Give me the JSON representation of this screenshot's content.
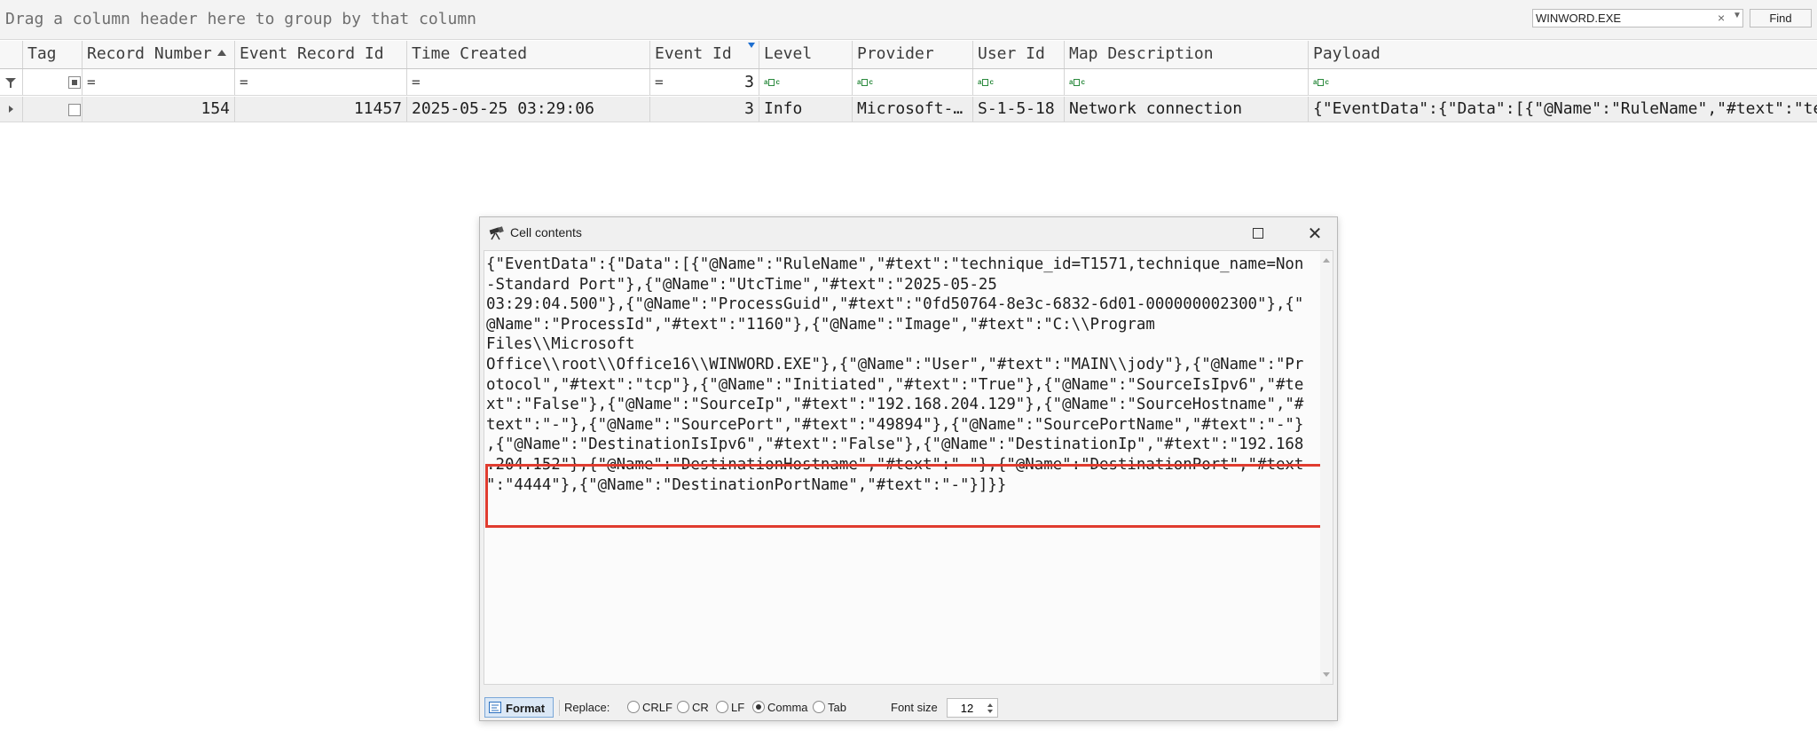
{
  "group_panel": {
    "hint": "Drag a column header here to group by that column",
    "search_value": "WINWORD.EXE",
    "find_label": "Find"
  },
  "columns": [
    {
      "label": "Tag"
    },
    {
      "label": "Record Number"
    },
    {
      "label": "Event Record Id"
    },
    {
      "label": "Time Created"
    },
    {
      "label": "Event Id"
    },
    {
      "label": "Level"
    },
    {
      "label": "Provider"
    },
    {
      "label": "User Id"
    },
    {
      "label": "Map Description"
    },
    {
      "label": "Payload"
    }
  ],
  "filter_row": {
    "eq": "=",
    "event_id_filter": "3"
  },
  "row": {
    "record_number": "154",
    "event_record_id": "11457",
    "time_created": "2025-05-25 03:29:06",
    "event_id": "3",
    "level": "Info",
    "provider": "Microsoft-Windows-Sysmon",
    "user_id": "S-1-5-18",
    "map_description": "Network connection",
    "payload": "{\"EventData\":{\"Data\":[{\"@Name\":\"RuleName\",\"#text\":\"technique_id=T1571,technique_name=Non-Standard Port\"}"
  },
  "dialog": {
    "title": "Cell contents",
    "lines": [
      "{\"EventData\":{\"Data\":[{\"@Name\":\"RuleName\",\"#text\":\"technique_id=T1571,technique_name=Non",
      "-Standard Port\"},{\"@Name\":\"UtcTime\",\"#text\":\"2025-05-25",
      "03:29:04.500\"},{\"@Name\":\"ProcessGuid\",\"#text\":\"0fd50764-8e3c-6832-6d01-000000002300\"},{\"",
      "@Name\":\"ProcessId\",\"#text\":\"1160\"},{\"@Name\":\"Image\",\"#text\":\"C:\\\\Program",
      "Files\\\\Microsoft",
      "Office\\\\root\\\\Office16\\\\WINWORD.EXE\"},{\"@Name\":\"User\",\"#text\":\"MAIN\\\\jody\"},{\"@Name\":\"Pr",
      "otocol\",\"#text\":\"tcp\"},{\"@Name\":\"Initiated\",\"#text\":\"True\"},{\"@Name\":\"SourceIsIpv6\",\"#te",
      "xt\":\"False\"},{\"@Name\":\"SourceIp\",\"#text\":\"192.168.204.129\"},{\"@Name\":\"SourceHostname\",\"#",
      "text\":\"-\"},{\"@Name\":\"SourcePort\",\"#text\":\"49894\"},{\"@Name\":\"SourcePortName\",\"#text\":\"-\"}",
      ",{\"@Name\":\"DestinationIsIpv6\",\"#text\":\"False\"},{\"@Name\":\"DestinationIp\",\"#text\":\"192.168",
      ".204.152\"},{\"@Name\":\"DestinationHostname\",\"#text\":\"-\"},{\"@Name\":\"DestinationPort\",\"#text",
      "\":\"4444\"},{\"@Name\":\"DestinationPortName\",\"#text\":\"-\"}]}}"
    ],
    "toolbar": {
      "format_label": "Format",
      "replace_label": "Replace:",
      "opt_crlf": "CRLF",
      "opt_cr": "CR",
      "opt_lf": "LF",
      "opt_comma": "Comma",
      "opt_tab": "Tab",
      "font_size_label": "Font size",
      "font_size_value": "12"
    }
  },
  "colors": {
    "highlight": "#e03c2f",
    "format_button_bg": "#dbe8f6"
  }
}
